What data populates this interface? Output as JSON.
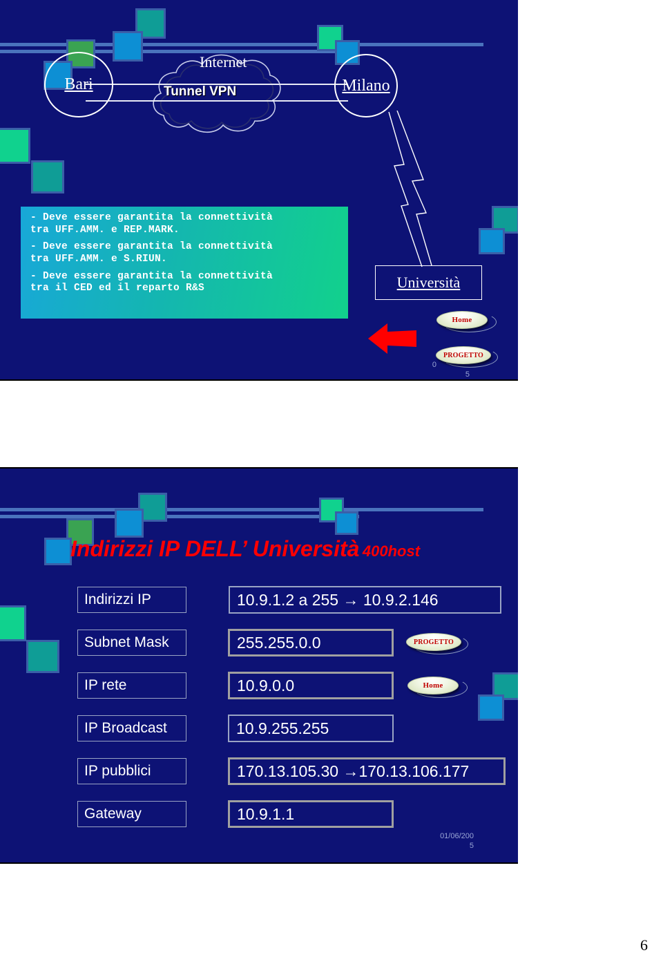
{
  "page": {
    "page_number": "6"
  },
  "slide1": {
    "diagram": {
      "node_left": "Bari",
      "node_right": "Milano",
      "cloud_label": "Internet",
      "tunnel_label": "Tunnel VPN",
      "university_label": "Università"
    },
    "requirements": [
      "- Deve essere garantita la connettività tra UFF.AMM. e REP.MARK.",
      "- Deve essere garantita la connettività tra UFF.AMM. e S.RIUN.",
      "- Deve essere garantita la connettività tra il CED ed il reparto R&S"
    ],
    "requirements_lines": [
      [
        "- Deve essere garantita la connettività",
        "tra UFF.AMM. e REP.MARK."
      ],
      [
        "- Deve essere garantita la connettività",
        "tra UFF.AMM. e S.RIUN."
      ],
      [
        "- Deve essere garantita la connettività",
        "tra il CED ed il reparto R&S"
      ]
    ],
    "buttons": {
      "home": "Home",
      "progetto": "PROGETTO"
    },
    "date_line1": "0",
    "date_line2": "5"
  },
  "slide2": {
    "title_main": "Indirizzi IP DELL’ Università",
    "title_sub": "400host",
    "table": {
      "rows": [
        {
          "label": "Indirizzi IP",
          "value": "10.9.1.2 a 255  → 10.9.2.146"
        },
        {
          "label": "Subnet Mask",
          "value": "255.255.0.0"
        },
        {
          "label": "IP rete",
          "value": "10.9.0.0"
        },
        {
          "label": "IP Broadcast",
          "value": "10.9.255.255"
        },
        {
          "label": "IP pubblici",
          "value": "170.13.105.30 →170.13.106.177"
        },
        {
          "label": "Gateway",
          "value": "10.9.1.1"
        }
      ]
    },
    "buttons": {
      "progetto": "PROGETTO",
      "home": "Home"
    },
    "date_line1": "01/06/200",
    "date_line2": "5"
  },
  "colors": {
    "slide_bg": "#0d1275",
    "accent_red": "#ff0000",
    "square_teal": "#0f9d96",
    "square_blue": "#0d8fd4",
    "square_green": "#3aa352",
    "square_spring": "#10d28e",
    "square_border": "#3a5fa8",
    "bar": "#4a73bd",
    "button_text": "#c00000"
  }
}
